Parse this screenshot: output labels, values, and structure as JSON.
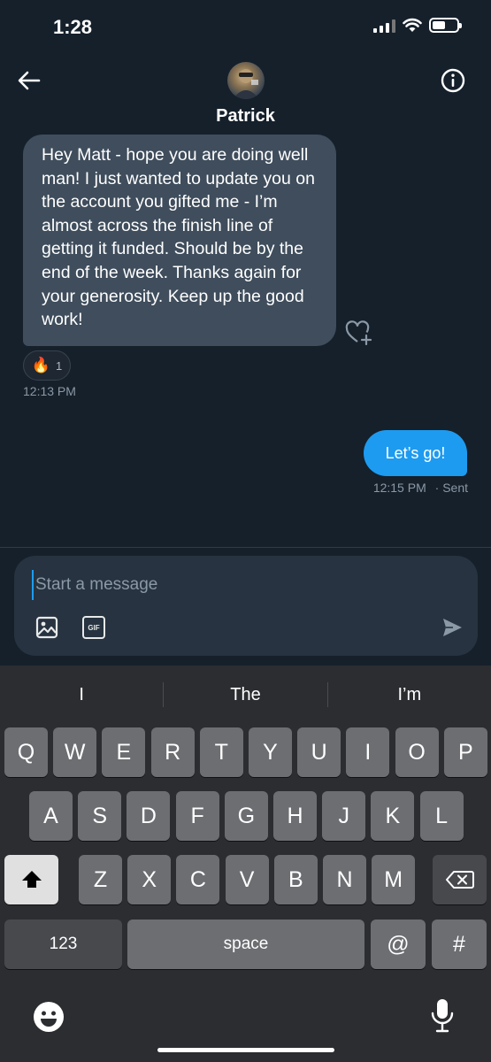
{
  "status": {
    "time": "1:28",
    "icons": [
      "cellular-signal-icon",
      "wifi-icon",
      "battery-icon"
    ]
  },
  "header": {
    "contact_name": "Patrick",
    "back_icon": "arrow-left-icon",
    "info_icon": "info-circle-icon"
  },
  "messages": {
    "incoming": {
      "text": "Hey Matt - hope you are doing well man! I just wanted to update you on the account you gifted me - I’m almost across the finish line of getting it funded. Should be by the end of the week. Thanks again for your generosity. Keep up the good work!",
      "timestamp": "12:13 PM",
      "reaction_emoji": "🔥",
      "reaction_count": "1"
    },
    "outgoing": {
      "text": "Let’s go!",
      "timestamp": "12:15 PM",
      "status": "· Sent"
    }
  },
  "composer": {
    "placeholder": "Start a message",
    "value": "",
    "gif_label": "GIF"
  },
  "keyboard": {
    "suggestions": [
      "I",
      "The",
      "I’m"
    ],
    "row1": [
      "Q",
      "W",
      "E",
      "R",
      "T",
      "Y",
      "U",
      "I",
      "O",
      "P"
    ],
    "row2": [
      "A",
      "S",
      "D",
      "F",
      "G",
      "H",
      "J",
      "K",
      "L"
    ],
    "row3": [
      "Z",
      "X",
      "C",
      "V",
      "B",
      "N",
      "M"
    ],
    "numbers_key": "123",
    "space_key": "space",
    "at_key": "@",
    "hash_key": "#"
  },
  "colors": {
    "background": "#15202b",
    "incoming_bubble": "#3f4d5c",
    "outgoing_bubble": "#1d9bf0",
    "keyboard_bg": "#2b2d30"
  }
}
